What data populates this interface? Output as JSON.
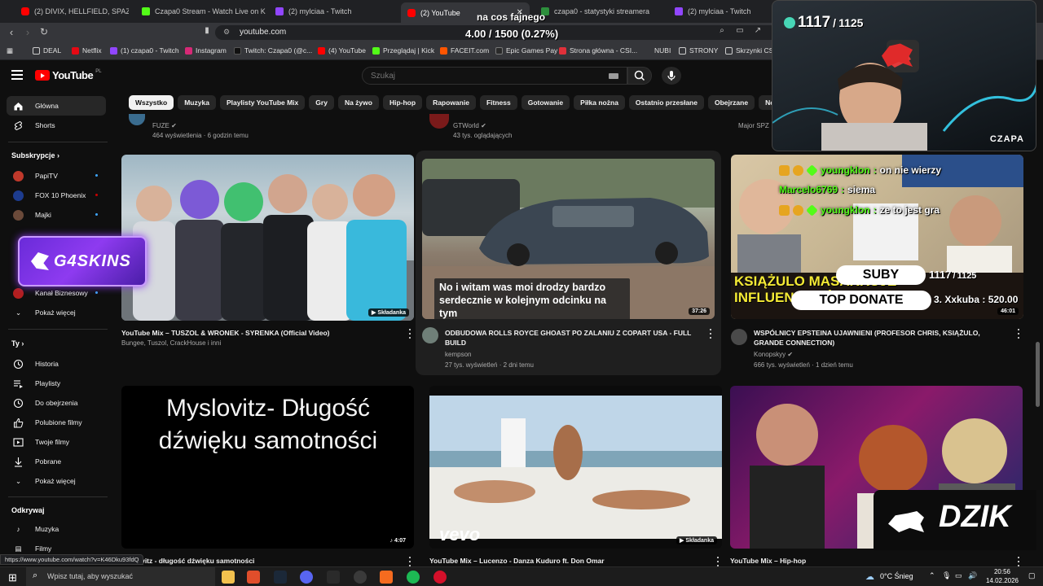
{
  "browser": {
    "tabs": [
      {
        "label": "(2) DIVIX, HELLFIELD, SPAZMA -",
        "icon": "youtube"
      },
      {
        "label": "Czapa0 Stream - Watch Live on Kick",
        "icon": "kick"
      },
      {
        "label": "(2) mylciaa - Twitch",
        "icon": "twitch"
      },
      {
        "label": "(2) YouTube",
        "icon": "youtube"
      },
      {
        "label": "czapa0 - statystyki streamera",
        "icon": "stats"
      },
      {
        "label": "(2) mylciaa - Twitch",
        "icon": "twitch"
      }
    ],
    "url": "youtube.com",
    "bookmarks": [
      "DEAL",
      "Netflix",
      "(1) czapa0 - Twitch",
      "Instagram",
      "Twitch: Czapa0 (@c...",
      "(4) YouTube",
      "Przeglądaj | Kick",
      "FACEIT.com",
      "Epic Games Pay",
      "Strona główna - CSI...",
      "NUBI",
      "STRONY",
      "Skrzynki CS"
    ],
    "status_url": "https://www.youtube.com/watch?v=K46Dku93fdQ"
  },
  "stream_overlay": {
    "goal_caption": "na cos fajnego",
    "goal_progress": "4.00 / 1500 (0.27%)",
    "sub_count": "1117",
    "sub_target": "1125",
    "streamer_name": "CZAPA",
    "sponsor_1": "G4SKINS",
    "sponsor_2": "DZIK",
    "suby_label": "SUBY",
    "top_donate_label": "TOP DONATE",
    "top_donate_entry": "3. Xxkuba : 520.00",
    "chat": [
      {
        "user": "youngklon",
        "message": "on nie wierzy"
      },
      {
        "user": "Marcelo6769",
        "message": "siema"
      },
      {
        "user": "youngklon",
        "message": "ze to jest gra"
      }
    ]
  },
  "youtube": {
    "logo_text": "YouTube",
    "country": "PL",
    "search_placeholder": "Szukaj",
    "chips": [
      "Wszystko",
      "Muzyka",
      "Playlisty YouTube Mix",
      "Gry",
      "Na żywo",
      "Hip-hop",
      "Rapowanie",
      "Fitness",
      "Gotowanie",
      "Piłka nożna",
      "Ostatnio przesłane",
      "Obejrzane",
      "Nowe reko"
    ],
    "sidebar": {
      "main": [
        {
          "label": "Główna",
          "icon": "home-icon"
        },
        {
          "label": "Shorts",
          "icon": "shorts-icon"
        }
      ],
      "subs_heading": "Subskrypcje",
      "subs": [
        {
          "label": "PapiTV",
          "color": "#c0392b"
        },
        {
          "label": "FOX 10 Phoenix",
          "color": "#1d3c8f"
        },
        {
          "label": "Majki",
          "color": "#6b4a3a"
        },
        {
          "label": "Kanał Biznesowy",
          "color": "#b21f1f"
        }
      ],
      "subs_more": "Pokaż więcej",
      "you_heading": "Ty",
      "you": [
        {
          "label": "Historia",
          "icon": "history-icon"
        },
        {
          "label": "Playlisty",
          "icon": "playlist-icon"
        },
        {
          "label": "Do obejrzenia",
          "icon": "watch-later-icon"
        },
        {
          "label": "Polubione filmy",
          "icon": "like-icon"
        },
        {
          "label": "Twoje filmy",
          "icon": "your-videos-icon"
        },
        {
          "label": "Pobrane",
          "icon": "download-icon"
        }
      ],
      "you_more": "Pokaż więcej",
      "explore_heading": "Odkrywaj",
      "explore": [
        {
          "label": "Muzyka",
          "icon": "music-icon"
        },
        {
          "label": "Filmy",
          "icon": "film-icon"
        }
      ]
    },
    "top_row": [
      {
        "channel": "FUZE",
        "stats": "464 wyświetlenia · 6 godzin temu"
      },
      {
        "channel": "GTWorld",
        "stats": "43 tys. oglądających"
      },
      {
        "channel": "Major SPZ"
      }
    ],
    "videos": [
      {
        "title": "YouTube Mix – TUSZOL & WRONEK - SYRENKA (Official Video)",
        "channel": "Bungee, Tuszol, CrackHouse i inni",
        "stats": "",
        "badge": "Składanka"
      },
      {
        "title": "ODBUDOWA ROLLS ROYCE GHOAST PO ZALANIU Z COPART USA - FULL BUILD",
        "channel": "kempson",
        "stats": "27 tys. wyświetleń · 2 dni temu",
        "duration": "37:26",
        "caption": "No i witam was moi drodzy bardzo serdecznie w kolejnym odcinku na tym"
      },
      {
        "title": "WSPÓLNICY EPSTEINA UJAWNIENI (PROFESOR CHRIS, KSIĄŻULO, GRANDE CONNECTION)",
        "channel": "Konopskyy",
        "stats": "666 tys. wyświetleń · 1 dzień temu",
        "duration": "46:01",
        "thumb_text": "KSIĄŻULO MASAKRUJE INFLUENCERÓW"
      },
      {
        "title": "Myslovitz - długość dźwięku samotności",
        "channel": "",
        "stats": "",
        "duration": "4:07",
        "thumb_text": "Myslovitz- Długość dźwięku samotności"
      },
      {
        "title": "YouTube Mix – Lucenzo - Danza Kuduro ft. Don Omar",
        "channel": "",
        "stats": "",
        "badge": "Składanka",
        "watermark": "vevo"
      },
      {
        "title": "YouTube Mix – Hip-hop",
        "channel": "",
        "stats": ""
      }
    ]
  },
  "taskbar": {
    "search_placeholder": "Wpisz tutaj, aby wyszukać",
    "weather": "0°C Śnieg",
    "time": "20:56",
    "date": "14.02.2026"
  }
}
